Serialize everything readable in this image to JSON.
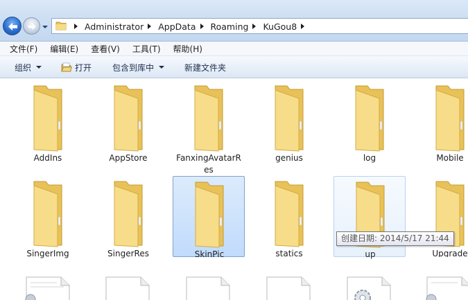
{
  "address": {
    "crumbs": [
      "Administrator",
      "AppData",
      "Roaming",
      "KuGou8"
    ]
  },
  "menu": [
    "文件(F)",
    "编辑(E)",
    "查看(V)",
    "工具(T)",
    "帮助(H)"
  ],
  "commands": {
    "organize": "组织",
    "open": "打开",
    "include_library": "包含到库中",
    "new_folder": "新建文件夹"
  },
  "folders_row1": [
    {
      "name": "AddIns"
    },
    {
      "name": "AppStore"
    },
    {
      "name": "FanxingAvatarRes"
    },
    {
      "name": "genius"
    },
    {
      "name": "log"
    },
    {
      "name": "Mobile"
    }
  ],
  "folders_row2": [
    {
      "name": "SingerImg"
    },
    {
      "name": "SingerRes"
    },
    {
      "name": "SkinPic",
      "state": "selected"
    },
    {
      "name": "statics"
    },
    {
      "name": "up",
      "state": "hovered"
    },
    {
      "name": "Upgrade"
    }
  ],
  "tooltip": {
    "text": "创建日期: 2014/5/17 21:44"
  },
  "colors": {
    "selection_fill": "#cce3fc",
    "selection_border": "#7da2ce",
    "folder_yellow": "#f1d57a"
  },
  "icons": {
    "back": "back-arrow-icon",
    "forward": "forward-arrow-icon",
    "folder": "folder-icon",
    "open": "open-folder-icon",
    "file": "document-icon",
    "settings_file": "config-file-icon"
  }
}
